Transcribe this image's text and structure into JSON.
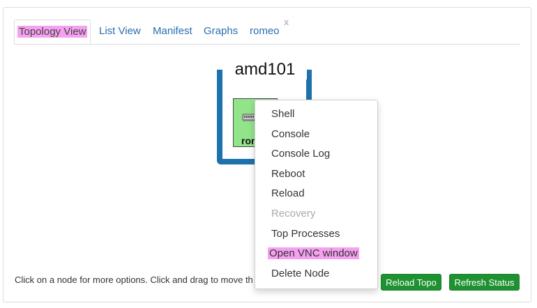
{
  "tabs": [
    {
      "label": "Topology View",
      "active": true
    },
    {
      "label": "List View"
    },
    {
      "label": "Manifest"
    },
    {
      "label": "Graphs"
    },
    {
      "label": "romeo"
    }
  ],
  "tab_close": "x",
  "topology": {
    "group_title": "amd101",
    "node": {
      "label": "romeo",
      "icon": "switch-icon",
      "color": "#92e48a"
    },
    "frame_color": "#1d71ad"
  },
  "context_menu": {
    "items": [
      {
        "label": "Shell"
      },
      {
        "label": "Console"
      },
      {
        "label": "Console Log"
      },
      {
        "label": "Reboot"
      },
      {
        "label": "Reload"
      },
      {
        "label": "Recovery",
        "disabled": true
      },
      {
        "label": "Top Processes"
      },
      {
        "label": "Open VNC window",
        "highlighted": true
      },
      {
        "label": "Delete Node"
      }
    ]
  },
  "footer": {
    "hint": "Click on a node for more options. Click and drag to move th",
    "reload_topo": "Reload Topo",
    "refresh_status": "Refresh Status",
    "button_color": "#1e9130"
  }
}
